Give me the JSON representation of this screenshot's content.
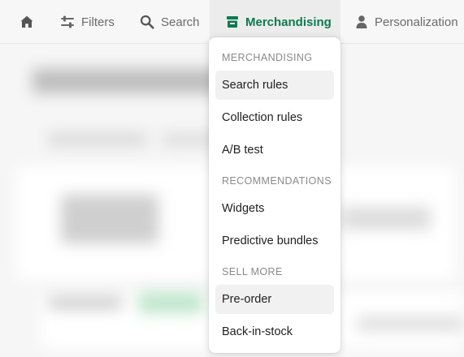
{
  "nav": {
    "items": [
      {
        "label": "",
        "icon": "home-icon"
      },
      {
        "label": "Filters",
        "icon": "sliders-icon"
      },
      {
        "label": "Search",
        "icon": "search-icon"
      },
      {
        "label": "Merchandising",
        "icon": "storefront-icon",
        "active": true
      },
      {
        "label": "Personalization",
        "icon": "person-icon"
      }
    ],
    "active_color": "#0d7a52"
  },
  "menu": {
    "sections": [
      {
        "title": "MERCHANDISING",
        "items": [
          "Search rules",
          "Collection rules",
          "A/B test"
        ]
      },
      {
        "title": "RECOMMENDATIONS",
        "items": [
          "Widgets",
          "Predictive bundles"
        ]
      },
      {
        "title": "SELL MORE",
        "items": [
          "Pre-order",
          "Back-in-stock"
        ]
      }
    ],
    "highlighted": [
      "Search rules",
      "Pre-order"
    ]
  }
}
